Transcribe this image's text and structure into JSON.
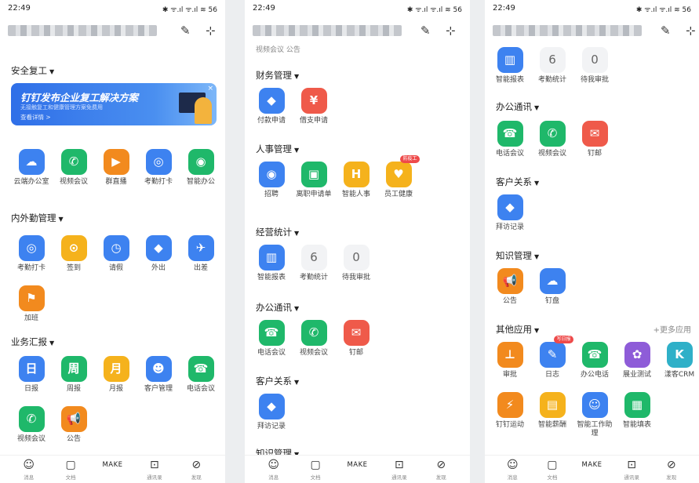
{
  "status": {
    "time": "22:49",
    "right": "✱ ᯤ.ıl ᯤ.ıl ≋ 56"
  },
  "colors": {
    "blue": "#3d82f0",
    "green": "#1fb86a",
    "orange": "#f28a1e",
    "red": "#ef5a4a",
    "yellow": "#f5b21c",
    "purple": "#8e5cd8",
    "teal": "#2fb0c8"
  },
  "tabs": [
    {
      "icon": "☺",
      "label": "消息"
    },
    {
      "icon": "▢",
      "label": "文档"
    },
    {
      "make": "MAKE",
      "label": ""
    },
    {
      "icon": "⊡",
      "label": "通讯录"
    },
    {
      "icon": "⊘",
      "label": "发现"
    }
  ],
  "p0": {
    "banner": {
      "title": "钉钉发布企业复工解决方案",
      "sub": "无接触复工和健康管理方案免费用",
      "link": "查看详情 >"
    },
    "sec_safety": "安全复工",
    "sec_field": "内外勤管理",
    "sec_report": "业务汇报",
    "safety": [
      {
        "label": "云端办公室",
        "icon": "cloud-icon"
      },
      {
        "label": "视频会议",
        "icon": "video-call-icon"
      },
      {
        "label": "群直播",
        "icon": "live-icon"
      },
      {
        "label": "考勤打卡",
        "icon": "checkin-icon"
      },
      {
        "label": "智能办公",
        "icon": "smart-office-icon"
      }
    ],
    "field": [
      {
        "label": "考勤打卡",
        "icon": "checkin-icon"
      },
      {
        "label": "签到",
        "icon": "signin-icon"
      },
      {
        "label": "请假",
        "icon": "leave-icon"
      },
      {
        "label": "外出",
        "icon": "outing-icon"
      },
      {
        "label": "出差",
        "icon": "trip-icon"
      },
      {
        "label": "加班",
        "icon": "overtime-icon"
      }
    ],
    "report": [
      {
        "label": "日报",
        "glyph": "日",
        "icon": "daily-report-icon"
      },
      {
        "label": "周报",
        "glyph": "周",
        "icon": "weekly-report-icon"
      },
      {
        "label": "月报",
        "glyph": "月",
        "icon": "monthly-report-icon"
      },
      {
        "label": "客户管理",
        "icon": "customer-icon"
      },
      {
        "label": "电话会议",
        "icon": "phone-meeting-icon"
      },
      {
        "label": "视频会议",
        "icon": "video-call-icon"
      },
      {
        "label": "公告",
        "icon": "announcement-icon"
      }
    ]
  },
  "p1": {
    "top_partial": "视频会议     公告",
    "sec_finance": "财务管理",
    "sec_hr": "人事管理",
    "sec_stats": "经营统计",
    "sec_comm": "办公通讯",
    "sec_crm": "客户关系",
    "sec_knowledge_partial": "知识管理",
    "finance": [
      {
        "label": "付款申请",
        "icon": "payment-icon"
      },
      {
        "label": "借支申请",
        "icon": "loan-icon"
      }
    ],
    "hr": [
      {
        "label": "招聘",
        "icon": "recruit-icon"
      },
      {
        "label": "离职申请单",
        "icon": "resign-icon"
      },
      {
        "label": "智能人事",
        "icon": "smart-hr-icon"
      },
      {
        "label": "员工健康",
        "icon": "health-icon",
        "tag": "防疫工"
      }
    ],
    "stats": [
      {
        "label": "智能报表",
        "icon": "report-chart-icon"
      },
      {
        "label": "考勤统计",
        "num": "6"
      },
      {
        "label": "待我审批",
        "num": "0"
      }
    ],
    "comm": [
      {
        "label": "电话会议",
        "icon": "phone-meeting-icon"
      },
      {
        "label": "视频会议",
        "icon": "video-call-icon"
      },
      {
        "label": "钉邮",
        "icon": "mail-icon"
      }
    ],
    "crm": [
      {
        "label": "拜访记录",
        "icon": "visit-icon"
      }
    ]
  },
  "p2": {
    "stats": [
      {
        "label": "智能报表",
        "icon": "report-chart-icon"
      },
      {
        "label": "考勤统计",
        "num": "6"
      },
      {
        "label": "待我审批",
        "num": "0"
      }
    ],
    "sec_comm": "办公通讯",
    "sec_crm": "客户关系",
    "sec_knowledge": "知识管理",
    "sec_other": "其他应用",
    "more": "+更多应用",
    "comm": [
      {
        "label": "电话会议",
        "icon": "phone-meeting-icon"
      },
      {
        "label": "视频会议",
        "icon": "video-call-icon"
      },
      {
        "label": "钉邮",
        "icon": "mail-icon"
      }
    ],
    "crm": [
      {
        "label": "拜访记录",
        "icon": "visit-icon"
      }
    ],
    "knowledge": [
      {
        "label": "公告",
        "icon": "announcement-icon"
      },
      {
        "label": "钉盘",
        "icon": "cloud-drive-icon"
      }
    ],
    "other": [
      {
        "label": "审批",
        "icon": "approval-icon"
      },
      {
        "label": "日志",
        "icon": "log-icon",
        "tag": "写日报"
      },
      {
        "label": "办公电话",
        "icon": "office-phone-icon"
      },
      {
        "label": "展业测试",
        "icon": "test-icon"
      },
      {
        "label": "漾客CRM",
        "icon": "crm-icon"
      },
      {
        "label": "钉钉运动",
        "icon": "sport-icon"
      },
      {
        "label": "智能薪酬",
        "icon": "salary-icon"
      },
      {
        "label": "智能工作助理",
        "icon": "assistant-icon"
      },
      {
        "label": "智能填表",
        "icon": "form-icon"
      }
    ]
  }
}
